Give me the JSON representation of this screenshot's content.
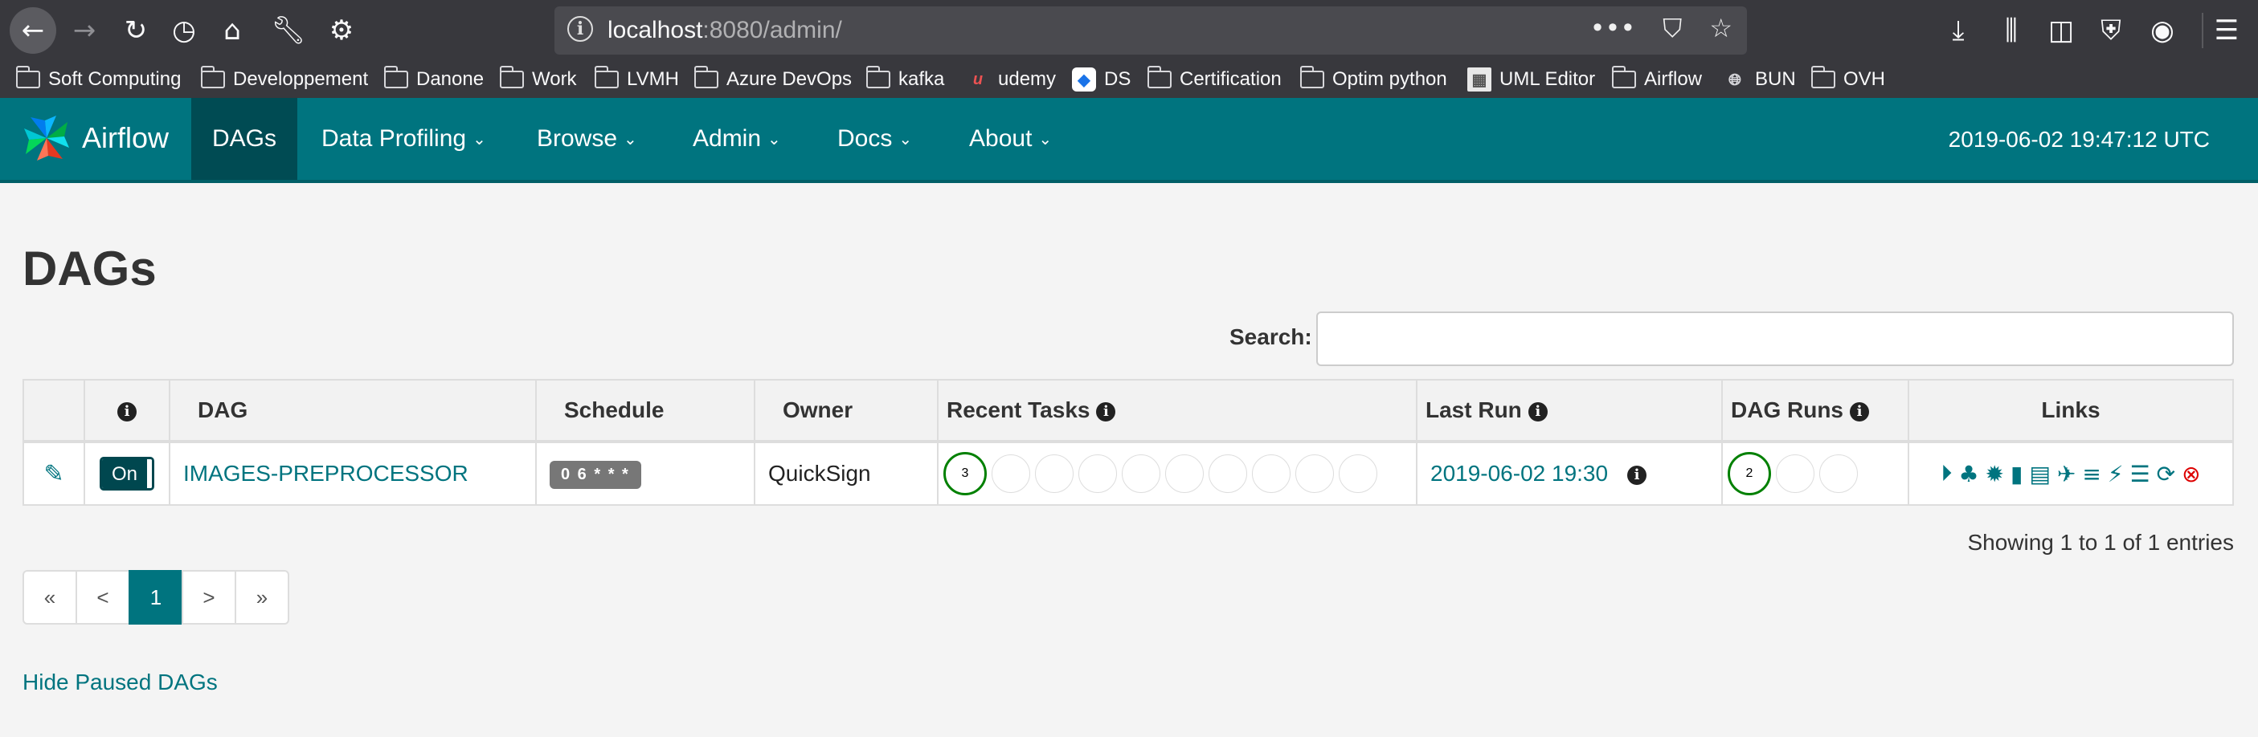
{
  "browser": {
    "url_host": "localhost",
    "url_rest": ":8080/admin/",
    "bookmarks": [
      {
        "label": "Soft Computing",
        "icon": "folder-icon"
      },
      {
        "label": "Developpement",
        "icon": "folder-icon"
      },
      {
        "label": "Danone",
        "icon": "folder-icon"
      },
      {
        "label": "Work",
        "icon": "folder-icon"
      },
      {
        "label": "LVMH",
        "icon": "folder-icon"
      },
      {
        "label": "Azure DevOps",
        "icon": "folder-icon"
      },
      {
        "label": "kafka",
        "icon": "folder-icon"
      },
      {
        "label": "udemy",
        "icon": "udemy-icon"
      },
      {
        "label": "DS",
        "icon": "ds-icon"
      },
      {
        "label": "Certification",
        "icon": "folder-icon"
      },
      {
        "label": "Optim python",
        "icon": "folder-icon"
      },
      {
        "label": "UML Editor",
        "icon": "uml-icon"
      },
      {
        "label": "Airflow",
        "icon": "folder-icon"
      },
      {
        "label": "BUN",
        "icon": "globe-icon"
      },
      {
        "label": "OVH",
        "icon": "folder-icon"
      }
    ]
  },
  "nav": {
    "brand": "Airflow",
    "items": [
      {
        "label": "DAGs"
      },
      {
        "label": "Data Profiling"
      },
      {
        "label": "Browse"
      },
      {
        "label": "Admin"
      },
      {
        "label": "Docs"
      },
      {
        "label": "About"
      }
    ],
    "time": "2019-06-02 19:47:12 UTC"
  },
  "page": {
    "title": "DAGs",
    "search_label": "Search:",
    "search_value": ""
  },
  "table": {
    "headers": {
      "dag": "DAG",
      "schedule": "Schedule",
      "owner": "Owner",
      "recent_tasks": "Recent Tasks",
      "last_run": "Last Run",
      "dag_runs": "DAG Runs",
      "links": "Links"
    },
    "rows": [
      {
        "toggle": "On",
        "dag_id": "IMAGES-PREPROCESSOR",
        "schedule": "0 6 * * *",
        "owner": "QuickSign",
        "recent_tasks_success": "3",
        "last_run": "2019-06-02 19:30",
        "dag_runs_success": "2"
      }
    ],
    "showing": "Showing 1 to 1 of 1 entries"
  },
  "pagination": [
    "«",
    "<",
    "1",
    ">",
    "»"
  ],
  "hide_paused": "Hide Paused DAGs",
  "colors": {
    "accent": "#00747f",
    "success": "#008000",
    "toggle": "#00474f"
  }
}
